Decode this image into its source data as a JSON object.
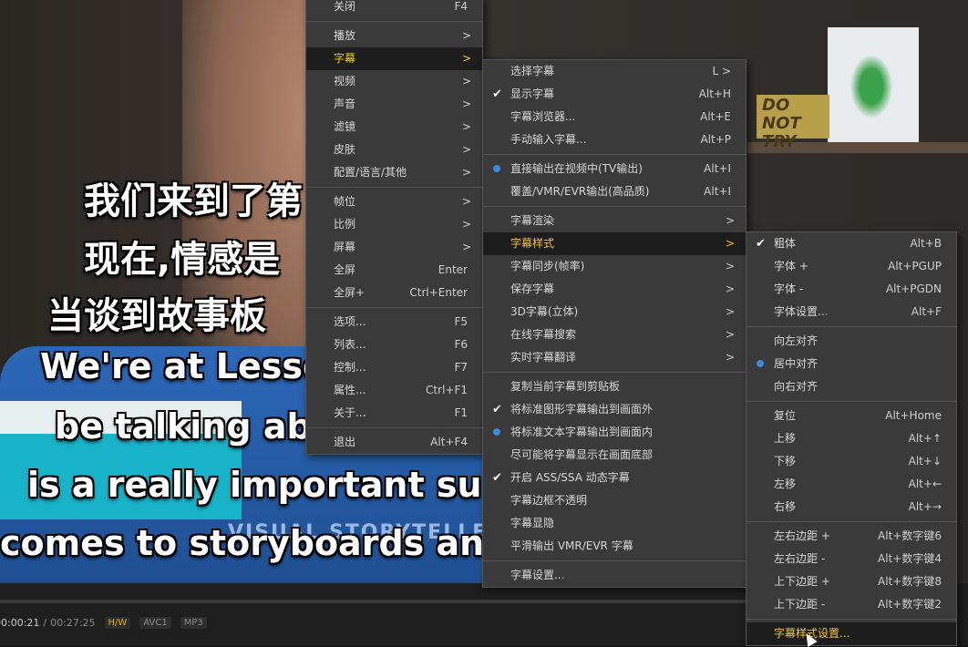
{
  "subtitles": {
    "cn": [
      "我们来到了第",
      "现在,情感是",
      "当谈到故事板"
    ],
    "en": [
      "We're at Lesso",
      "be talking abo",
      "is a really important subj",
      "comes to storyboards and "
    ]
  },
  "background": {
    "sign_text": "DO NOT TRY",
    "shirt_text": "VISUAL STORYTELLER"
  },
  "controls": {
    "current_time": "00:00:21",
    "separator": "/",
    "total_time": "00:27:25",
    "tags": [
      "H/W",
      "AVC1",
      "MP3"
    ]
  },
  "main_menu": [
    {
      "label": "关闭",
      "shortcut": "F4"
    },
    {
      "sep": true
    },
    {
      "label": "播放",
      "arrow": ">"
    },
    {
      "label": "字幕",
      "arrow": ">",
      "active": true
    },
    {
      "label": "视频",
      "arrow": ">"
    },
    {
      "label": "声音",
      "arrow": ">"
    },
    {
      "label": "滤镜",
      "arrow": ">"
    },
    {
      "label": "皮肤",
      "arrow": ">"
    },
    {
      "label": "配置/语言/其他",
      "arrow": ">"
    },
    {
      "sep": true
    },
    {
      "label": "帧位",
      "arrow": ">"
    },
    {
      "label": "比例",
      "arrow": ">"
    },
    {
      "label": "屏幕",
      "arrow": ">"
    },
    {
      "label": "全屏",
      "shortcut": "Enter"
    },
    {
      "label": "全屏+",
      "shortcut": "Ctrl+Enter"
    },
    {
      "sep": true
    },
    {
      "label": "选项...",
      "shortcut": "F5"
    },
    {
      "label": "列表...",
      "shortcut": "F6"
    },
    {
      "label": "控制...",
      "shortcut": "F7"
    },
    {
      "label": "属性...",
      "shortcut": "Ctrl+F1"
    },
    {
      "label": "关于...",
      "shortcut": "F1"
    },
    {
      "sep": true
    },
    {
      "label": "退出",
      "shortcut": "Alt+F4"
    }
  ],
  "subtitle_menu": [
    {
      "label": "选择字幕",
      "shortcut": "L >"
    },
    {
      "label": "显示字幕",
      "shortcut": "Alt+H",
      "check": true
    },
    {
      "label": "字幕浏览器...",
      "shortcut": "Alt+E"
    },
    {
      "label": "手动输入字幕...",
      "shortcut": "Alt+P"
    },
    {
      "sep": true
    },
    {
      "label": "直接输出在视频中(TV输出)",
      "shortcut": "Alt+I",
      "radio": true
    },
    {
      "label": "覆盖/VMR/EVR输出(高品质)",
      "shortcut": "Alt+I"
    },
    {
      "sep": true
    },
    {
      "label": "字幕渲染",
      "arrow": ">"
    },
    {
      "label": "字幕样式",
      "arrow": ">",
      "active": true
    },
    {
      "label": "字幕同步(帧率)",
      "arrow": ">"
    },
    {
      "label": "保存字幕",
      "arrow": ">"
    },
    {
      "label": "3D字幕(立体)",
      "arrow": ">"
    },
    {
      "label": "在线字幕搜索",
      "arrow": ">"
    },
    {
      "label": "实时字幕翻译",
      "arrow": ">"
    },
    {
      "sep": true
    },
    {
      "label": "复制当前字幕到剪贴板"
    },
    {
      "label": "将标准图形字幕输出到画面外",
      "check": true
    },
    {
      "label": "将标准文本字幕输出到画面内",
      "radio": true
    },
    {
      "label": "尽可能将字幕显示在画面底部"
    },
    {
      "label": "开启 ASS/SSA 动态字幕",
      "check": true
    },
    {
      "label": "字幕边框不透明"
    },
    {
      "label": "字幕显隐"
    },
    {
      "label": "平滑输出 VMR/EVR 字幕"
    },
    {
      "sep": true
    },
    {
      "label": "字幕设置..."
    }
  ],
  "style_menu": [
    {
      "label": "粗体",
      "shortcut": "Alt+B",
      "check": true
    },
    {
      "label": "字体 +",
      "shortcut": "Alt+PGUP"
    },
    {
      "label": "字体 -",
      "shortcut": "Alt+PGDN"
    },
    {
      "label": "字体设置...",
      "shortcut": "Alt+F"
    },
    {
      "sep": true
    },
    {
      "label": "向左对齐"
    },
    {
      "label": "居中对齐",
      "radio": true
    },
    {
      "label": "向右对齐"
    },
    {
      "sep": true
    },
    {
      "label": "复位",
      "shortcut": "Alt+Home"
    },
    {
      "label": "上移",
      "shortcut": "Alt+↑"
    },
    {
      "label": "下移",
      "shortcut": "Alt+↓"
    },
    {
      "label": "左移",
      "shortcut": "Alt+←"
    },
    {
      "label": "右移",
      "shortcut": "Alt+→"
    },
    {
      "sep": true
    },
    {
      "label": "左右边距 +",
      "shortcut": "Alt+数字键6"
    },
    {
      "label": "左右边距 -",
      "shortcut": "Alt+数字键4"
    },
    {
      "label": "上下边距 +",
      "shortcut": "Alt+数字键8"
    },
    {
      "label": "上下边距 -",
      "shortcut": "Alt+数字键2"
    },
    {
      "sep": true
    },
    {
      "label": "字幕样式设置...",
      "active": true
    }
  ],
  "colors": {
    "accent": "#f0c419",
    "menu_bg": "#3a3a3a",
    "check_blue": "#3b8ae0"
  }
}
